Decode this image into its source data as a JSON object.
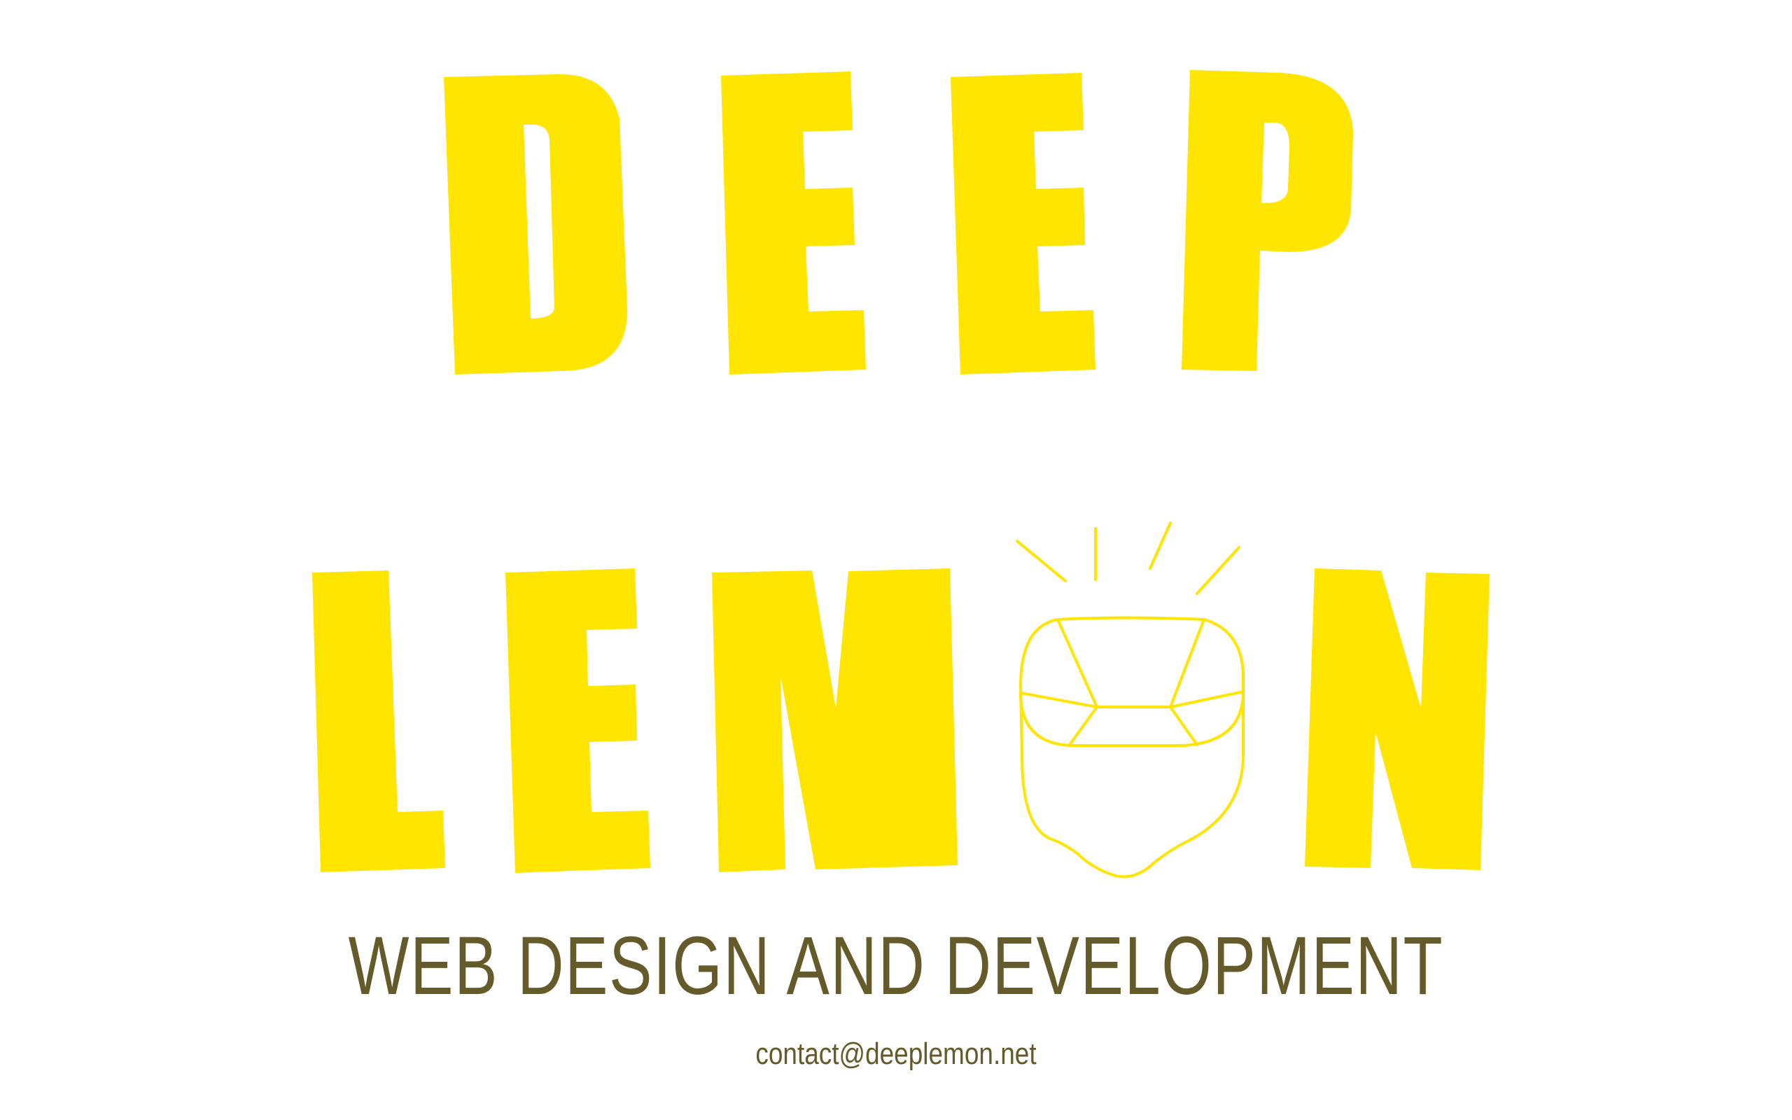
{
  "brand": {
    "line1": "DEEP",
    "line2": "LEMON",
    "colors": {
      "logo_yellow": "#FFE500",
      "text_olive": "#655A2A",
      "background": "#FFFFFF"
    }
  },
  "tagline": "WEB DESIGN AND DEVELOPMENT",
  "contact_email": "contact@deeplemon.net"
}
